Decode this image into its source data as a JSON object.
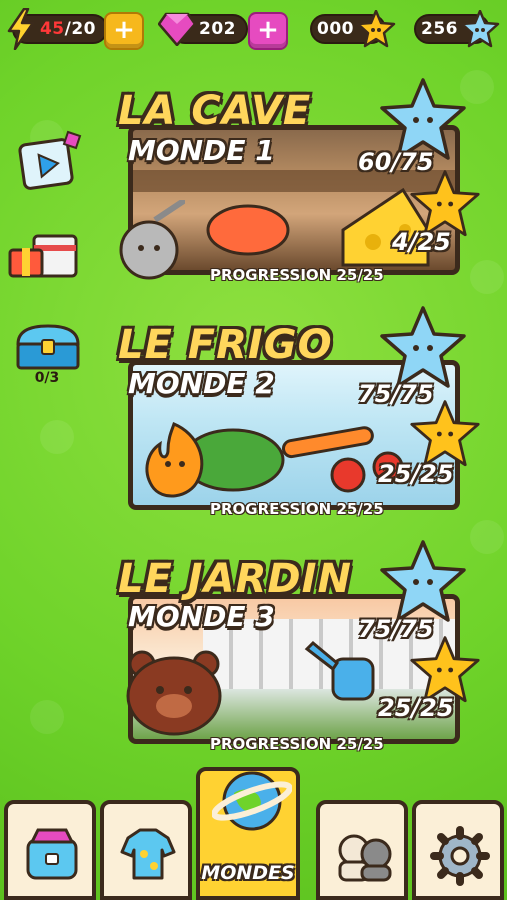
{
  "top_bar": {
    "energy": {
      "current": "45",
      "max": "/20",
      "icon": "lightning-icon"
    },
    "gems": {
      "value": "202",
      "icon": "gem-icon"
    },
    "gold_stars": {
      "value": "000",
      "icon": "gold-cat-star-icon"
    },
    "blue_stars": {
      "value": "256",
      "icon": "blue-cat-star-icon"
    }
  },
  "side": {
    "chest_counter": "0/3"
  },
  "worlds": [
    {
      "title": "LA CAVE",
      "subtitle": "MONDE 1",
      "blue_score": "60/75",
      "gold_score": "4/25",
      "progress": "PROGRESSION 25/25"
    },
    {
      "title": "LE FRIGO",
      "subtitle": "MONDE 2",
      "blue_score": "75/75",
      "gold_score": "25/25",
      "progress": "PROGRESSION 25/25"
    },
    {
      "title": "LE JARDIN",
      "subtitle": "MONDE 3",
      "blue_score": "75/75",
      "gold_score": "25/25",
      "progress": "PROGRESSION 25/25"
    }
  ],
  "nav": {
    "active_label": "MONDES",
    "items": [
      "shop-icon",
      "costume-icon",
      "planet-icon",
      "friends-icon",
      "settings-gear-icon"
    ]
  },
  "colors": {
    "background": "#6fd32a",
    "title_yellow": "#ffd65c",
    "outline_brown": "#3b2a1c",
    "energy_red": "#ff3838",
    "plus_yellow": "#f6b81c",
    "plus_pink": "#e64bc0"
  }
}
